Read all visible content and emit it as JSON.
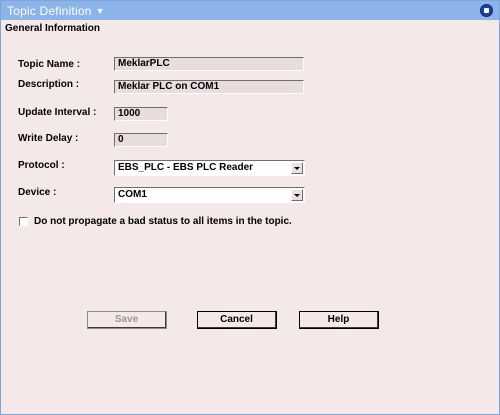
{
  "window": {
    "title": "Topic Definition",
    "section_title": "General Information"
  },
  "form": {
    "topic_name_label": "Topic Name :",
    "topic_name_value": "MeklarPLC",
    "description_label": "Description :",
    "description_value": "Meklar PLC on COM1",
    "update_interval_label": "Update Interval :",
    "update_interval_value": "1000",
    "write_delay_label": "Write Delay :",
    "write_delay_value": "0",
    "protocol_label": "Protocol :",
    "protocol_value": "EBS_PLC - EBS PLC Reader",
    "device_label": "Device :",
    "device_value": "COM1",
    "propagate_label": "Do not propagate a bad status to all items in the topic.",
    "propagate_checked": false
  },
  "buttons": {
    "save": "Save",
    "cancel": "Cancel",
    "help": "Help"
  }
}
